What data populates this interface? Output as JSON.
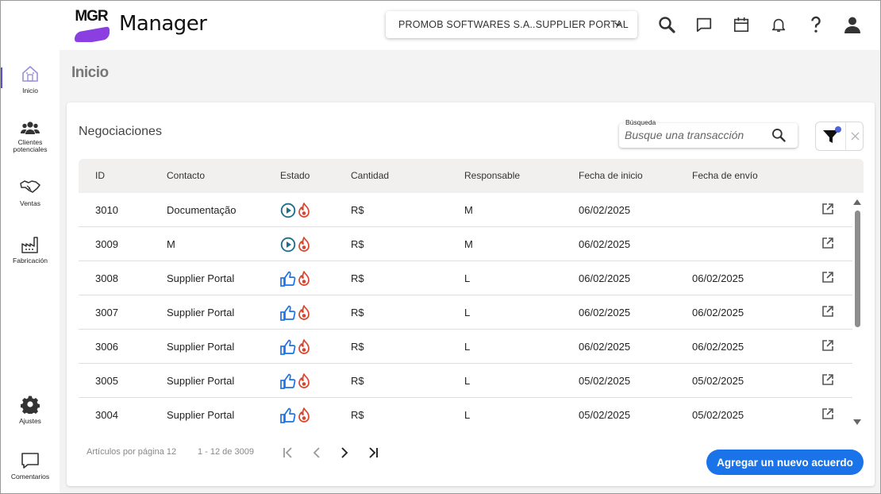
{
  "app": {
    "logo_text": "MGR",
    "name": "Manager",
    "company_selector": "PROMOB SOFTWARES S.A..SUPPLIER PORTAL"
  },
  "sidebar": {
    "items": [
      {
        "label": "Inicio",
        "icon": "home-icon"
      },
      {
        "label": "Clientes potenciales",
        "icon": "people-icon"
      },
      {
        "label": "Ventas",
        "icon": "handshake-icon"
      },
      {
        "label": "Fabricación",
        "icon": "factory-icon"
      },
      {
        "label": "Ajustes",
        "icon": "gear-icon"
      },
      {
        "label": "Comentarios",
        "icon": "comment-icon"
      }
    ]
  },
  "page": {
    "title": "Inicio"
  },
  "card": {
    "title": "Negociaciones",
    "search": {
      "label": "Búsqueda",
      "placeholder": "Busque una transacción"
    }
  },
  "table": {
    "columns": [
      "ID",
      "Contacto",
      "Estado",
      "Cantidad",
      "Responsable",
      "Fecha de inicio",
      "Fecha de envío"
    ],
    "rows": [
      {
        "id": "3010",
        "contact": "Documentação",
        "status": "in-progress",
        "amount": "R$",
        "owner": "M",
        "start": "06/02/2025",
        "ship": ""
      },
      {
        "id": "3009",
        "contact": "M",
        "status": "in-progress",
        "amount": "R$",
        "owner": "M",
        "start": "06/02/2025",
        "ship": ""
      },
      {
        "id": "3008",
        "contact": "Supplier Portal",
        "status": "approved",
        "amount": "R$",
        "owner": "L",
        "start": "06/02/2025",
        "ship": "06/02/2025"
      },
      {
        "id": "3007",
        "contact": "Supplier Portal",
        "status": "approved",
        "amount": "R$",
        "owner": "L",
        "start": "06/02/2025",
        "ship": "06/02/2025"
      },
      {
        "id": "3006",
        "contact": "Supplier Portal",
        "status": "approved",
        "amount": "R$",
        "owner": "L",
        "start": "06/02/2025",
        "ship": "06/02/2025"
      },
      {
        "id": "3005",
        "contact": "Supplier Portal",
        "status": "approved",
        "amount": "R$",
        "owner": "L",
        "start": "05/02/2025",
        "ship": "05/02/2025"
      },
      {
        "id": "3004",
        "contact": "Supplier Portal",
        "status": "approved",
        "amount": "R$",
        "owner": "L",
        "start": "05/02/2025",
        "ship": "05/02/2025"
      }
    ]
  },
  "pagination": {
    "per_page_label": "Artículos por página",
    "per_page_value": "12",
    "range": "1 - 12 de 3009"
  },
  "actions": {
    "add_deal": "Agregar un nuevo acuerdo"
  },
  "colors": {
    "accent": "#1a73e8",
    "brand_purple": "#8b3fe0",
    "thumb_blue": "#1a73e8",
    "flame_red": "#d9452f",
    "play_teal": "#1f6f8b"
  }
}
